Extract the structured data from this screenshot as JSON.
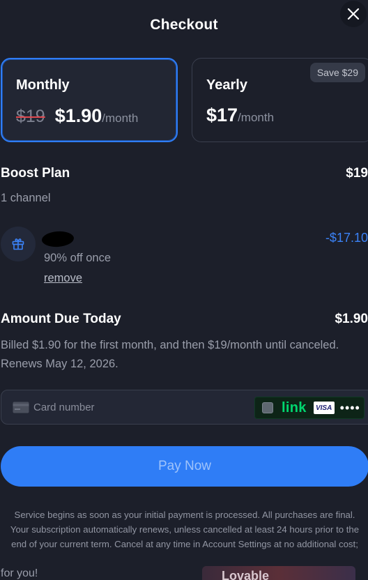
{
  "header": {
    "title": "Checkout"
  },
  "plans": {
    "monthly": {
      "name": "Monthly",
      "old_price": "$19",
      "price": "$1.90",
      "per": "/month",
      "selected": true
    },
    "yearly": {
      "name": "Yearly",
      "badge": "Save $29",
      "price": "$17",
      "per": "/month",
      "selected": false
    }
  },
  "line_item": {
    "name": "Boost Plan",
    "detail": "1 channel",
    "amount": "$19"
  },
  "discount": {
    "description": "90% off once",
    "amount": "-$17.10",
    "remove_label": "remove",
    "icon": "gift-icon"
  },
  "due": {
    "label": "Amount Due Today",
    "amount": "$1.90",
    "note_line1": "Billed $1.90 for the first month, and then $19/month until canceled.",
    "note_line2": "Renews May 12, 2026."
  },
  "payment": {
    "card_placeholder": "Card number",
    "link_label": "link",
    "visa_label": "VISA",
    "masked_dots": "••••"
  },
  "actions": {
    "pay_label": "Pay Now"
  },
  "terms": {
    "line1": "Service begins as soon as your initial payment is processed. All purchases are final.",
    "line2": "Your subscription automatically renews, unless cancelled at least 24 hours prior to the",
    "line3": "end of your current term. Cancel at any time in Account Settings at no additional cost;"
  },
  "footer": {
    "text": "for you!",
    "logo_text": "Lovable"
  },
  "colors": {
    "accent": "#2f7df6",
    "discount": "#3b82f6",
    "background": "#1c1f2a",
    "link_green": "#00d66f"
  }
}
